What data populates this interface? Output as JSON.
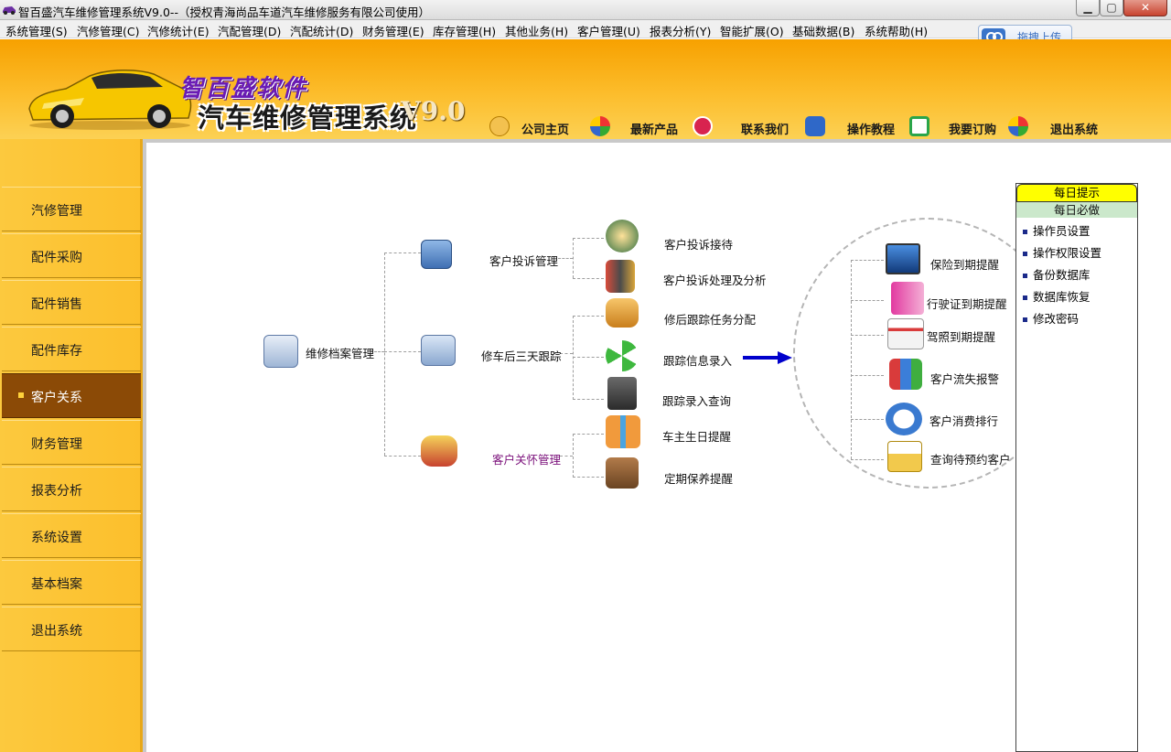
{
  "window": {
    "title": "智百盛汽车维修管理系统V9.0--（授权青海尚品车道汽车维修服务有限公司使用）",
    "minimize": "▁",
    "maximize": "▢",
    "close": "✕"
  },
  "menubar": {
    "items": [
      "系统管理(S)",
      "汽修管理(C)",
      "汽修统计(E)",
      "汽配管理(D)",
      "汽配统计(D)",
      "财务管理(E)",
      "库存管理(H)",
      "其他业务(H)",
      "客户管理(U)",
      "报表分析(Y)",
      "智能扩展(O)",
      "基础数据(B)",
      "系统帮助(H)"
    ],
    "upload_label": "拖拽上传"
  },
  "banner": {
    "brand_line1": "智百盛软件",
    "brand_line2": "汽车维修管理系统",
    "version": "V9.0",
    "nav": [
      "公司主页",
      "最新产品",
      "联系我们",
      "操作教程",
      "我要订购",
      "退出系统"
    ]
  },
  "sidebar": {
    "items": [
      "汽修管理",
      "配件采购",
      "配件销售",
      "配件库存",
      "客户关系",
      "财务管理",
      "报表分析",
      "系统设置",
      "基本档案",
      "退出系统"
    ],
    "active": "客户关系"
  },
  "flow": {
    "root": "维修档案管理",
    "groups": [
      "客户投诉管理",
      "修车后三天跟踪",
      "客户关怀管理"
    ],
    "leaves": [
      "客户投诉接待",
      "客户投诉处理及分析",
      "修后跟踪任务分配",
      "跟踪信息录入",
      "跟踪录入查询",
      "车主生日提醒",
      "定期保养提醒"
    ],
    "reminders": [
      "保险到期提醒",
      "行驶证到期提醒",
      "驾照到期提醒",
      "客户流失报警",
      "客户消费排行",
      "查询待预约客户"
    ]
  },
  "daily_panel": {
    "header": "每日提示",
    "subheader": "每日必做",
    "items": [
      "操作员设置",
      "操作权限设置",
      "备份数据库",
      "数据库恢复",
      "修改密码"
    ]
  },
  "colors": {
    "banner_top": "#f7a100",
    "banner_bottom": "#fcd154",
    "sidebar_bg": "#fcc93e",
    "active_item": "#8b4a06",
    "brand_purple": "#6a1bb5",
    "arrow_blue": "#0000cc",
    "panel_header": "#ffff00"
  }
}
